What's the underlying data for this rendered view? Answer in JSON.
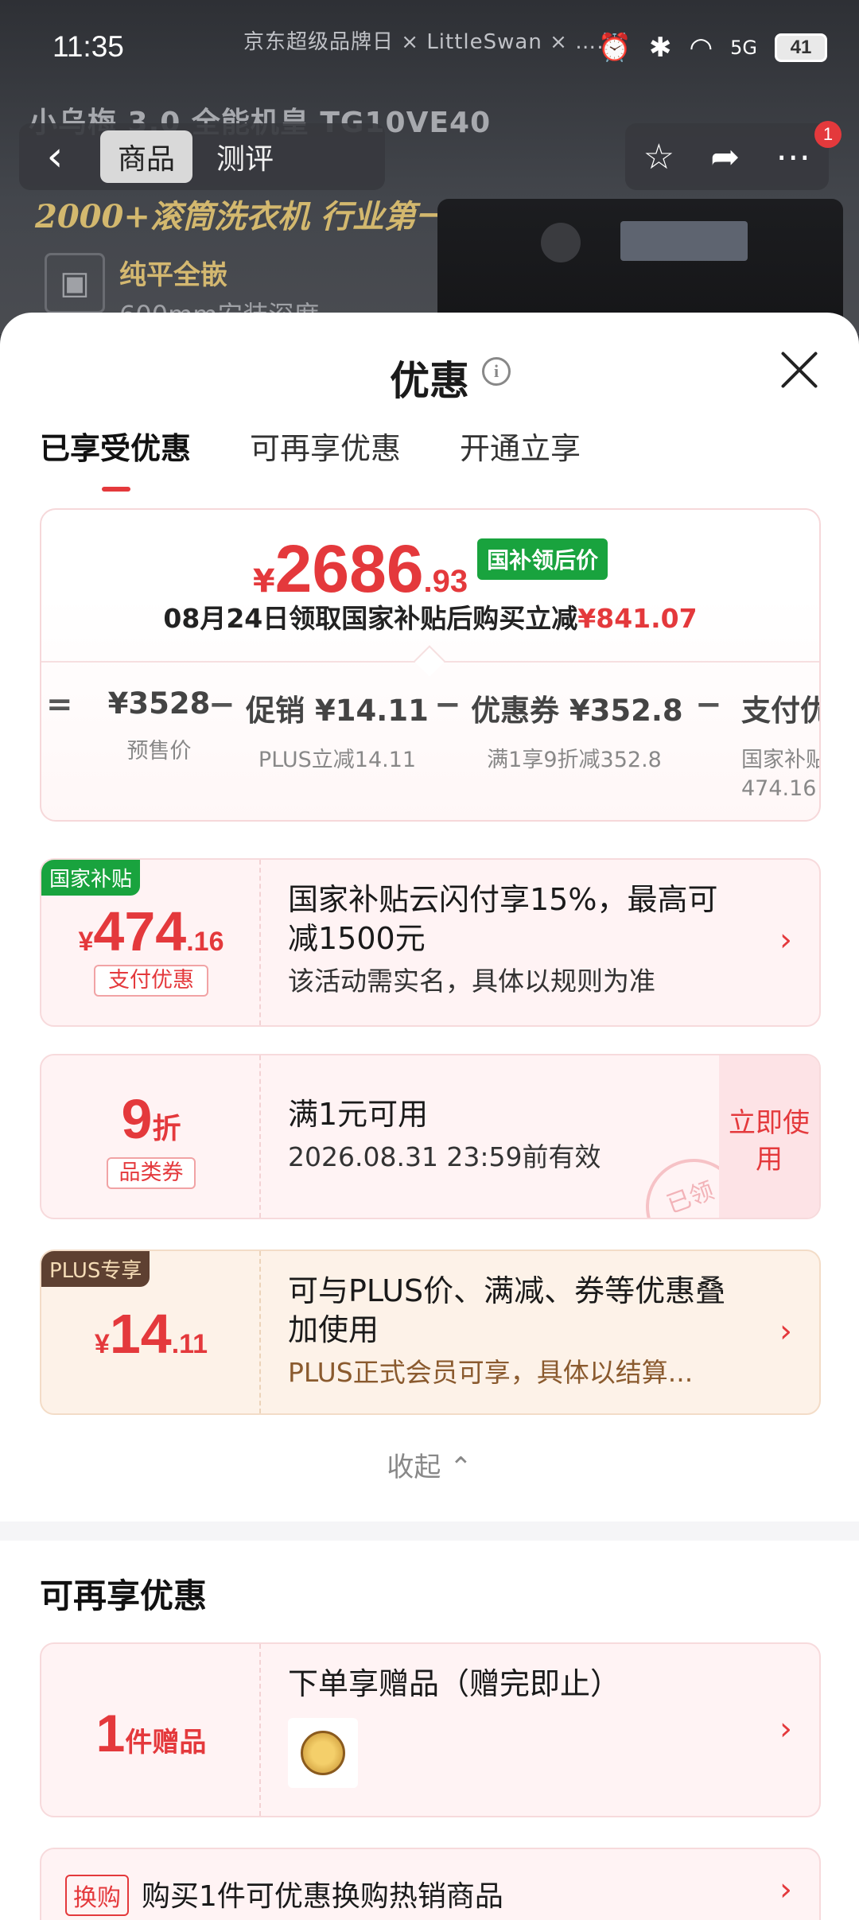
{
  "status_bar": {
    "time": "11:35",
    "brand_line": "京东超级品牌日 × LittleSwan × ……",
    "network": "5G",
    "battery": "41"
  },
  "product_page": {
    "title": "小乌梅 3.0 全能机皇 TG10VE40",
    "slogan": "2000+滚筒洗衣机 行业第一",
    "feature_title": "纯平全嵌",
    "feature_sub": "600mm安装深度",
    "tabs": [
      "商品",
      "测评"
    ],
    "notification_count": "1"
  },
  "sheet": {
    "title": "优惠",
    "tabs": [
      "已享受优惠",
      "可再享优惠",
      "开通立享"
    ]
  },
  "price_summary": {
    "yen": "¥",
    "price_int": "2686",
    "price_dec": ".93",
    "price_tag": "国补领后价",
    "subtitle_prefix": "08月24日领取国家补贴后购买立减",
    "subtitle_amount": "¥841.07",
    "breakdown": [
      {
        "value": "¥3528",
        "label": "预售价"
      },
      {
        "value": "促销 ¥14.11",
        "label": "PLUS立减14.11"
      },
      {
        "value": "优惠券 ¥352.8",
        "label": "满1享9折减352.8"
      },
      {
        "value": "支付优",
        "label": "国家补贴",
        "label2": "474.16"
      }
    ],
    "ops": [
      "=",
      "−",
      "−",
      "−"
    ]
  },
  "coupons": [
    {
      "tag": "国家补贴",
      "amount_yen": "¥",
      "amount_int": "474",
      "amount_dec": ".16",
      "badge": "支付优惠",
      "line1": "国家补贴云闪付享15%，最高可减1500元",
      "line2": "该活动需实名，具体以规则为准"
    },
    {
      "amount_int": "9",
      "amount_unit": "折",
      "badge": "品类券",
      "line1": "满1元可用",
      "line2": "2026.08.31 23:59前有效",
      "action": "立即使用",
      "stamp": "已领"
    },
    {
      "tag": "PLUS专享",
      "amount_yen": "¥",
      "amount_int": "14",
      "amount_dec": ".11",
      "line1": "可与PLUS价、满减、券等优惠叠加使用",
      "line2": "PLUS正式会员可享，具体以结算..."
    }
  ],
  "collapse_label": "收起",
  "more_section": {
    "title": "可再享优惠",
    "gift": {
      "count": "1",
      "unit": "件赠品",
      "line1": "下单享赠品（赠完即止）"
    },
    "swap": {
      "tag": "换购",
      "line1": "购买1件可优惠换购热销商品"
    }
  },
  "colors": {
    "accent": "#e4393c",
    "green_tag": "#19a33e",
    "plus_brown": "#5e4031"
  }
}
